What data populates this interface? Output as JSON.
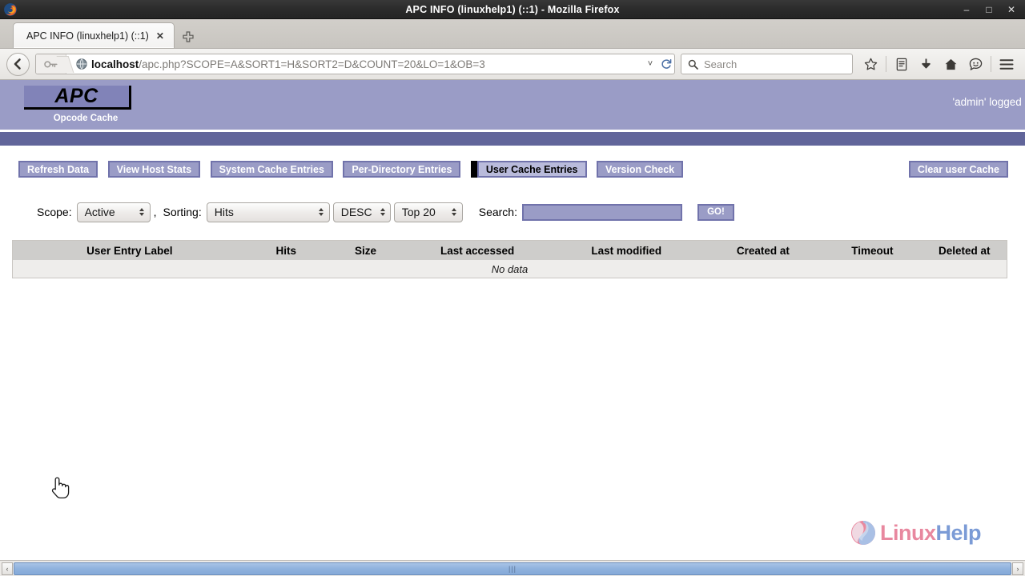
{
  "window": {
    "title": "APC INFO (linuxhelp1) (::1) - Mozilla Firefox",
    "minimize_label": "–",
    "maximize_label": "□",
    "close_label": "✕"
  },
  "browser": {
    "tab": {
      "title": "APC INFO (linuxhelp1) (::1)",
      "close_label": "✕"
    },
    "new_tab_label": "✚",
    "back_label": "←",
    "url_host": "localhost",
    "url_path": "/apc.php?SCOPE=A&SORT1=H&SORT2=D&COUNT=20&LO=1&OB=3",
    "dropdown_marker": "˅",
    "reload_label": "↻",
    "search_placeholder": "Search",
    "icons": {
      "bookmark": "☆",
      "reader": "☰",
      "downloads": "↓",
      "home": "⌂",
      "chat": "☺",
      "menu": "≡"
    }
  },
  "page": {
    "logo_title": "APC",
    "logo_subtitle": "Opcode Cache",
    "logged_in": "'admin' logged in",
    "menu_buttons": [
      {
        "label": "Refresh Data",
        "active": false
      },
      {
        "label": "View Host Stats",
        "active": false
      },
      {
        "label": "System Cache Entries",
        "active": false
      },
      {
        "label": "Per-Directory Entries",
        "active": false
      },
      {
        "label": "User Cache Entries",
        "active": true
      },
      {
        "label": "Version Check",
        "active": false
      }
    ],
    "clear_button": "Clear user Cache",
    "controls": {
      "scope_label": "Scope:",
      "scope_value": "Active",
      "comma": ",",
      "sorting_label": "Sorting:",
      "sort_field_value": "Hits",
      "sort_dir_value": "DESC",
      "count_value": "Top 20",
      "search_label": "Search:",
      "search_value": "",
      "go_label": "GO!"
    },
    "table": {
      "headers": [
        "User Entry Label",
        "Hits",
        "Size",
        "Last accessed",
        "Last modified",
        "Created at",
        "Timeout",
        "Deleted at"
      ],
      "empty_message": "No data"
    },
    "footer_logo": {
      "part1": "Linux",
      "part2": "Help"
    }
  },
  "scrollbar": {
    "left_arrow": "‹",
    "right_arrow": "›",
    "grip": "|||"
  }
}
